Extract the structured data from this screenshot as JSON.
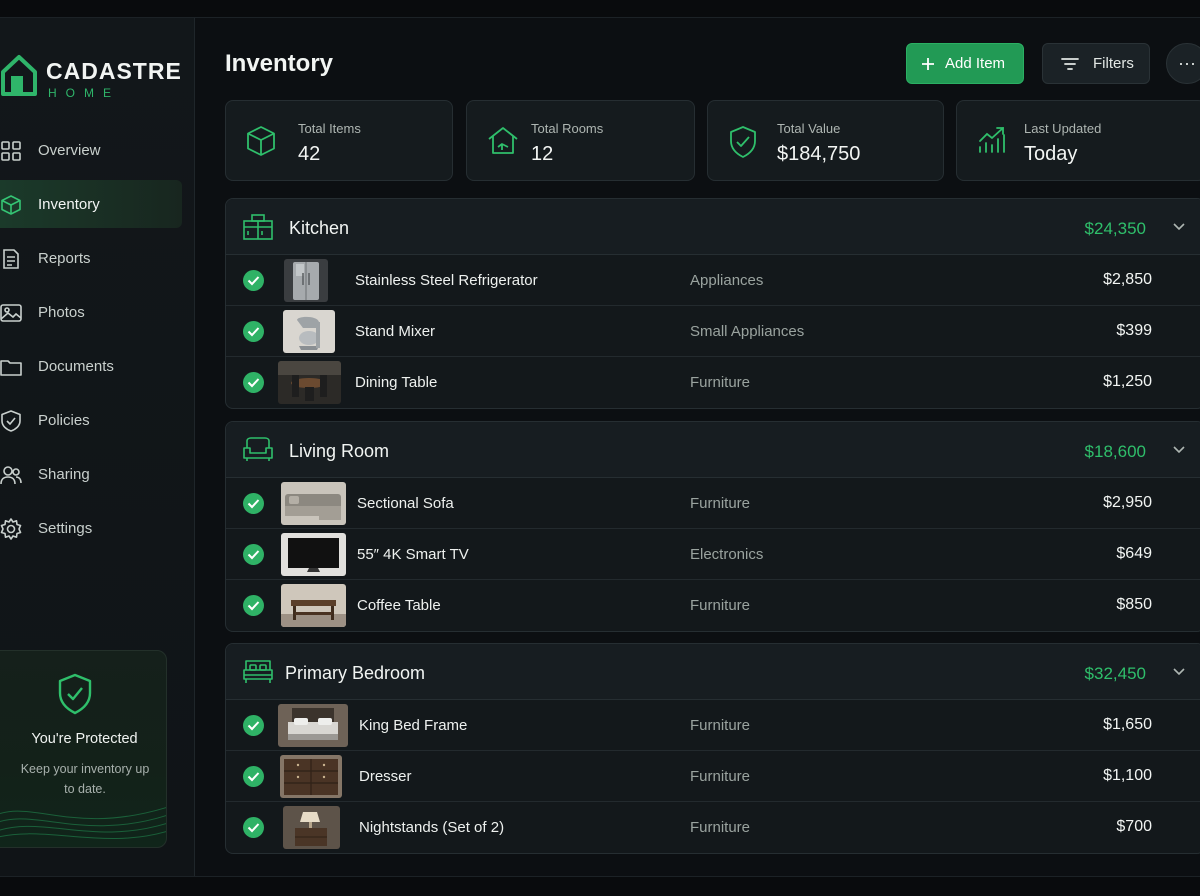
{
  "brand": {
    "name": "CADASTRE",
    "sub": "HOME",
    "accent": "#2fb56a"
  },
  "nav": [
    {
      "label": "Overview",
      "icon": "grid-icon"
    },
    {
      "label": "Inventory",
      "icon": "cube-icon",
      "active": true
    },
    {
      "label": "Reports",
      "icon": "document-icon"
    },
    {
      "label": "Photos",
      "icon": "image-icon"
    },
    {
      "label": "Documents",
      "icon": "folder-icon"
    },
    {
      "label": "Policies",
      "icon": "shield-icon"
    },
    {
      "label": "Sharing",
      "icon": "users-icon"
    },
    {
      "label": "Settings",
      "icon": "gear-icon"
    }
  ],
  "protection": {
    "title": "You're Protected",
    "subtitle": "Keep your inventory up to date."
  },
  "page": {
    "title": "Inventory"
  },
  "toolbar": {
    "add_label": "Add Item",
    "filters_label": "Filters",
    "more_label": "···"
  },
  "stats": [
    {
      "label": "Total Items",
      "value": "42",
      "icon": "cube-icon"
    },
    {
      "label": "Total Rooms",
      "value": "12",
      "icon": "house-icon"
    },
    {
      "label": "Total Value",
      "value": "$184,750",
      "icon": "shield-check-icon"
    },
    {
      "label": "Last Updated",
      "value": "Today",
      "icon": "trend-chart-icon"
    }
  ],
  "rooms": [
    {
      "name": "Kitchen",
      "total": "$24,350",
      "icon": "kitchen-icon",
      "items": [
        {
          "name": "Stainless Steel Refrigerator",
          "category": "Appliances",
          "value": "$2,850",
          "thumb": "refrigerator-photo"
        },
        {
          "name": "Stand Mixer",
          "category": "Small Appliances",
          "value": "$399",
          "thumb": "mixer-photo"
        },
        {
          "name": "Dining Table",
          "category": "Furniture",
          "value": "$1,250",
          "thumb": "dining-table-photo"
        }
      ]
    },
    {
      "name": "Living Room",
      "total": "$18,600",
      "icon": "sofa-icon",
      "items": [
        {
          "name": "Sectional Sofa",
          "category": "Furniture",
          "value": "$2,950",
          "thumb": "sofa-photo"
        },
        {
          "name": "55″ 4K Smart TV",
          "category": "Electronics",
          "value": "$649",
          "thumb": "tv-photo"
        },
        {
          "name": "Coffee Table",
          "category": "Furniture",
          "value": "$850",
          "thumb": "coffee-table-photo"
        }
      ]
    },
    {
      "name": "Primary Bedroom",
      "total": "$32,450",
      "icon": "bed-icon",
      "items": [
        {
          "name": "King Bed Frame",
          "category": "Furniture",
          "value": "$1,650",
          "thumb": "bed-photo"
        },
        {
          "name": "Dresser",
          "category": "Furniture",
          "value": "$1,100",
          "thumb": "dresser-photo"
        },
        {
          "name": "Nightstands (Set of 2)",
          "category": "Furniture",
          "value": "$700",
          "thumb": "nightstand-photo"
        }
      ]
    }
  ]
}
